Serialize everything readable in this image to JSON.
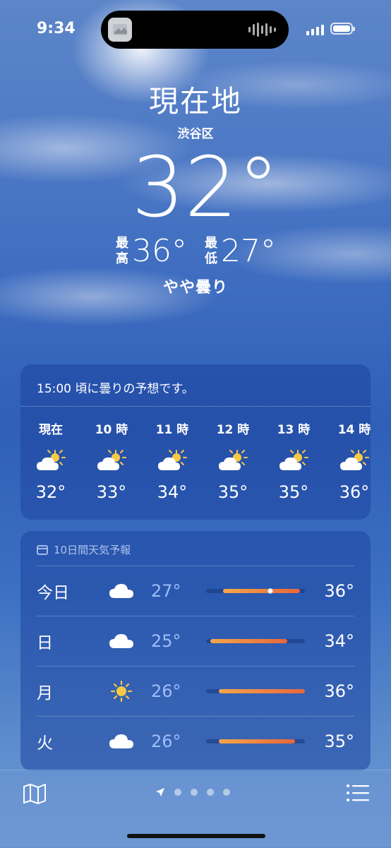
{
  "status_bar": {
    "time": "9:34"
  },
  "header": {
    "location": "現在地",
    "area": "渋谷区",
    "current_temp": "32°",
    "high_label": "最高",
    "high": "36°",
    "low_label": "最低",
    "low": "27°",
    "condition": "やや曇り"
  },
  "hourly": {
    "summary": "15:00 頃に曇りの予想です。",
    "items": [
      {
        "time": "現在",
        "icon": "partly-cloudy-icon",
        "temp": "32°"
      },
      {
        "time": "10 時",
        "icon": "partly-cloudy-icon",
        "temp": "33°"
      },
      {
        "time": "11 時",
        "icon": "partly-cloudy-icon",
        "temp": "34°"
      },
      {
        "time": "12 時",
        "icon": "partly-cloudy-icon",
        "temp": "35°"
      },
      {
        "time": "13 時",
        "icon": "partly-cloudy-icon",
        "temp": "35°"
      },
      {
        "time": "14 時",
        "icon": "partly-cloudy-icon",
        "temp": "36°"
      }
    ]
  },
  "forecast": {
    "title": "10日間天気予報",
    "days": [
      {
        "day": "今日",
        "icon": "cloud-icon",
        "low": "27°",
        "high": "36°",
        "range_start": 0.17,
        "range_end": 0.95,
        "current": 0.65
      },
      {
        "day": "日",
        "icon": "cloud-icon",
        "low": "25°",
        "high": "34°",
        "range_start": 0.04,
        "range_end": 0.82
      },
      {
        "day": "月",
        "icon": "sun-icon",
        "low": "26°",
        "high": "36°",
        "range_start": 0.13,
        "range_end": 1.0
      },
      {
        "day": "火",
        "icon": "cloud-icon",
        "low": "26°",
        "high": "35°",
        "range_start": 0.13,
        "range_end": 0.9
      }
    ]
  },
  "toolbar": {
    "page_count": 4
  },
  "colors": {
    "accent_gradient_start": "#f3a64a",
    "accent_gradient_end": "#e8663c"
  }
}
